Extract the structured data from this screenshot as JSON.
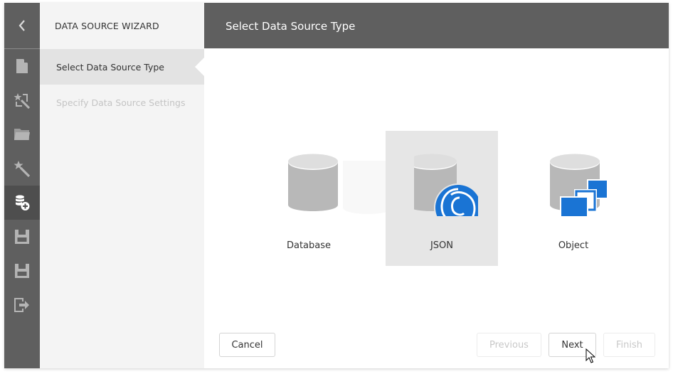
{
  "toolbar": {
    "items": [
      {
        "icon": "back-chevron-icon"
      },
      {
        "icon": "new-report-icon"
      },
      {
        "icon": "report-wizard-icon"
      },
      {
        "icon": "open-folder-icon"
      },
      {
        "icon": "magic-wand-icon"
      },
      {
        "icon": "add-data-source-icon",
        "active": true
      },
      {
        "icon": "save-icon"
      },
      {
        "icon": "save-as-icon"
      },
      {
        "icon": "exit-icon"
      }
    ]
  },
  "wizard": {
    "title": "DATA SOURCE WIZARD",
    "steps": [
      {
        "label": "Select Data Source Type",
        "state": "current"
      },
      {
        "label": "Specify Data Source Settings",
        "state": "pending"
      }
    ]
  },
  "main": {
    "title": "Select Data Source Type",
    "options": [
      {
        "label": "Database",
        "icon": "database-icon",
        "selected": false
      },
      {
        "label": "JSON",
        "icon": "json-database-icon",
        "selected": true
      },
      {
        "label": "Object",
        "icon": "object-database-icon",
        "selected": false
      }
    ]
  },
  "footer": {
    "cancel": "Cancel",
    "previous": "Previous",
    "next": "Next",
    "finish": "Finish"
  },
  "colors": {
    "toolbar_bg": "#5f5f5f",
    "accent_blue": "#1a74d4",
    "selected_tile": "#e6e6e6"
  }
}
